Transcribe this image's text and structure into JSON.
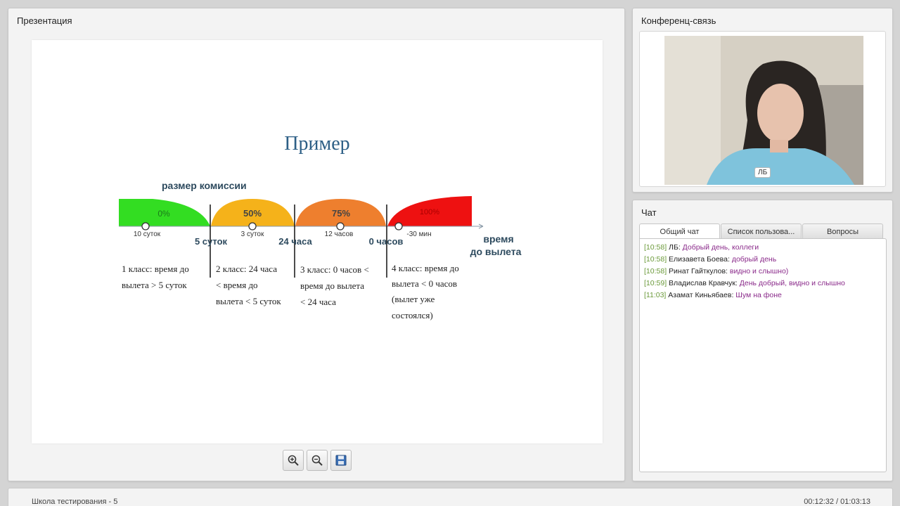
{
  "presentation": {
    "title": "Презентация",
    "slide": {
      "heading": "Пример",
      "commission_label": "размер комиссии",
      "segments": [
        {
          "pct": "0%",
          "color": "#33dd22",
          "marker": "10 суток"
        },
        {
          "pct": "50%",
          "color": "#f5b21a",
          "marker": "3 суток"
        },
        {
          "pct": "75%",
          "color": "#ee7f2e",
          "marker": "12 часов"
        },
        {
          "pct": "100%",
          "color": "#ee1111",
          "marker": "-30 мин"
        }
      ],
      "boundaries": [
        "5 суток",
        "24 часа",
        "0 часов"
      ],
      "axis_label_1": "время",
      "axis_label_2": "до вылета",
      "classes": [
        [
          "1 класс: время до",
          "вылета > 5 суток"
        ],
        [
          "2 класс: 24 часа",
          "< время до",
          "вылета < 5 суток"
        ],
        [
          "3 класс: 0 часов <",
          "время до вылета",
          "< 24 часа"
        ],
        [
          "4 класс: время до",
          "вылета < 0 часов",
          "(вылет уже",
          "состоялся)"
        ]
      ]
    },
    "toolbar": {
      "zoom_in_icon": "zoom-in-icon",
      "zoom_out_icon": "zoom-out-icon",
      "save_icon": "save-icon"
    }
  },
  "conference": {
    "title": "Конференц-связь",
    "participant_badge": "ЛБ"
  },
  "chat": {
    "title": "Чат",
    "tabs": [
      "Общий чат",
      "Список пользова...",
      "Вопросы"
    ],
    "active_tab": 0,
    "messages": [
      {
        "time": "[10:58]",
        "author": "ЛБ:",
        "text": "Добрый день, коллеги"
      },
      {
        "time": "[10:58]",
        "author": "Елизавета Боева:",
        "text": "добрый день"
      },
      {
        "time": "[10:58]",
        "author": "Ринат Гайткулов:",
        "text": "видно и слышно)"
      },
      {
        "time": "[10:59]",
        "author": "Владислав Кравчук:",
        "text": "День добрый, видно и слышно"
      },
      {
        "time": "[11:03]",
        "author": "Азамат Киньябаев:",
        "text": "Шум на фоне"
      }
    ]
  },
  "footer": {
    "course": "Школа тестирования - 5",
    "playback": "00:12:32 / 01:03:13"
  }
}
